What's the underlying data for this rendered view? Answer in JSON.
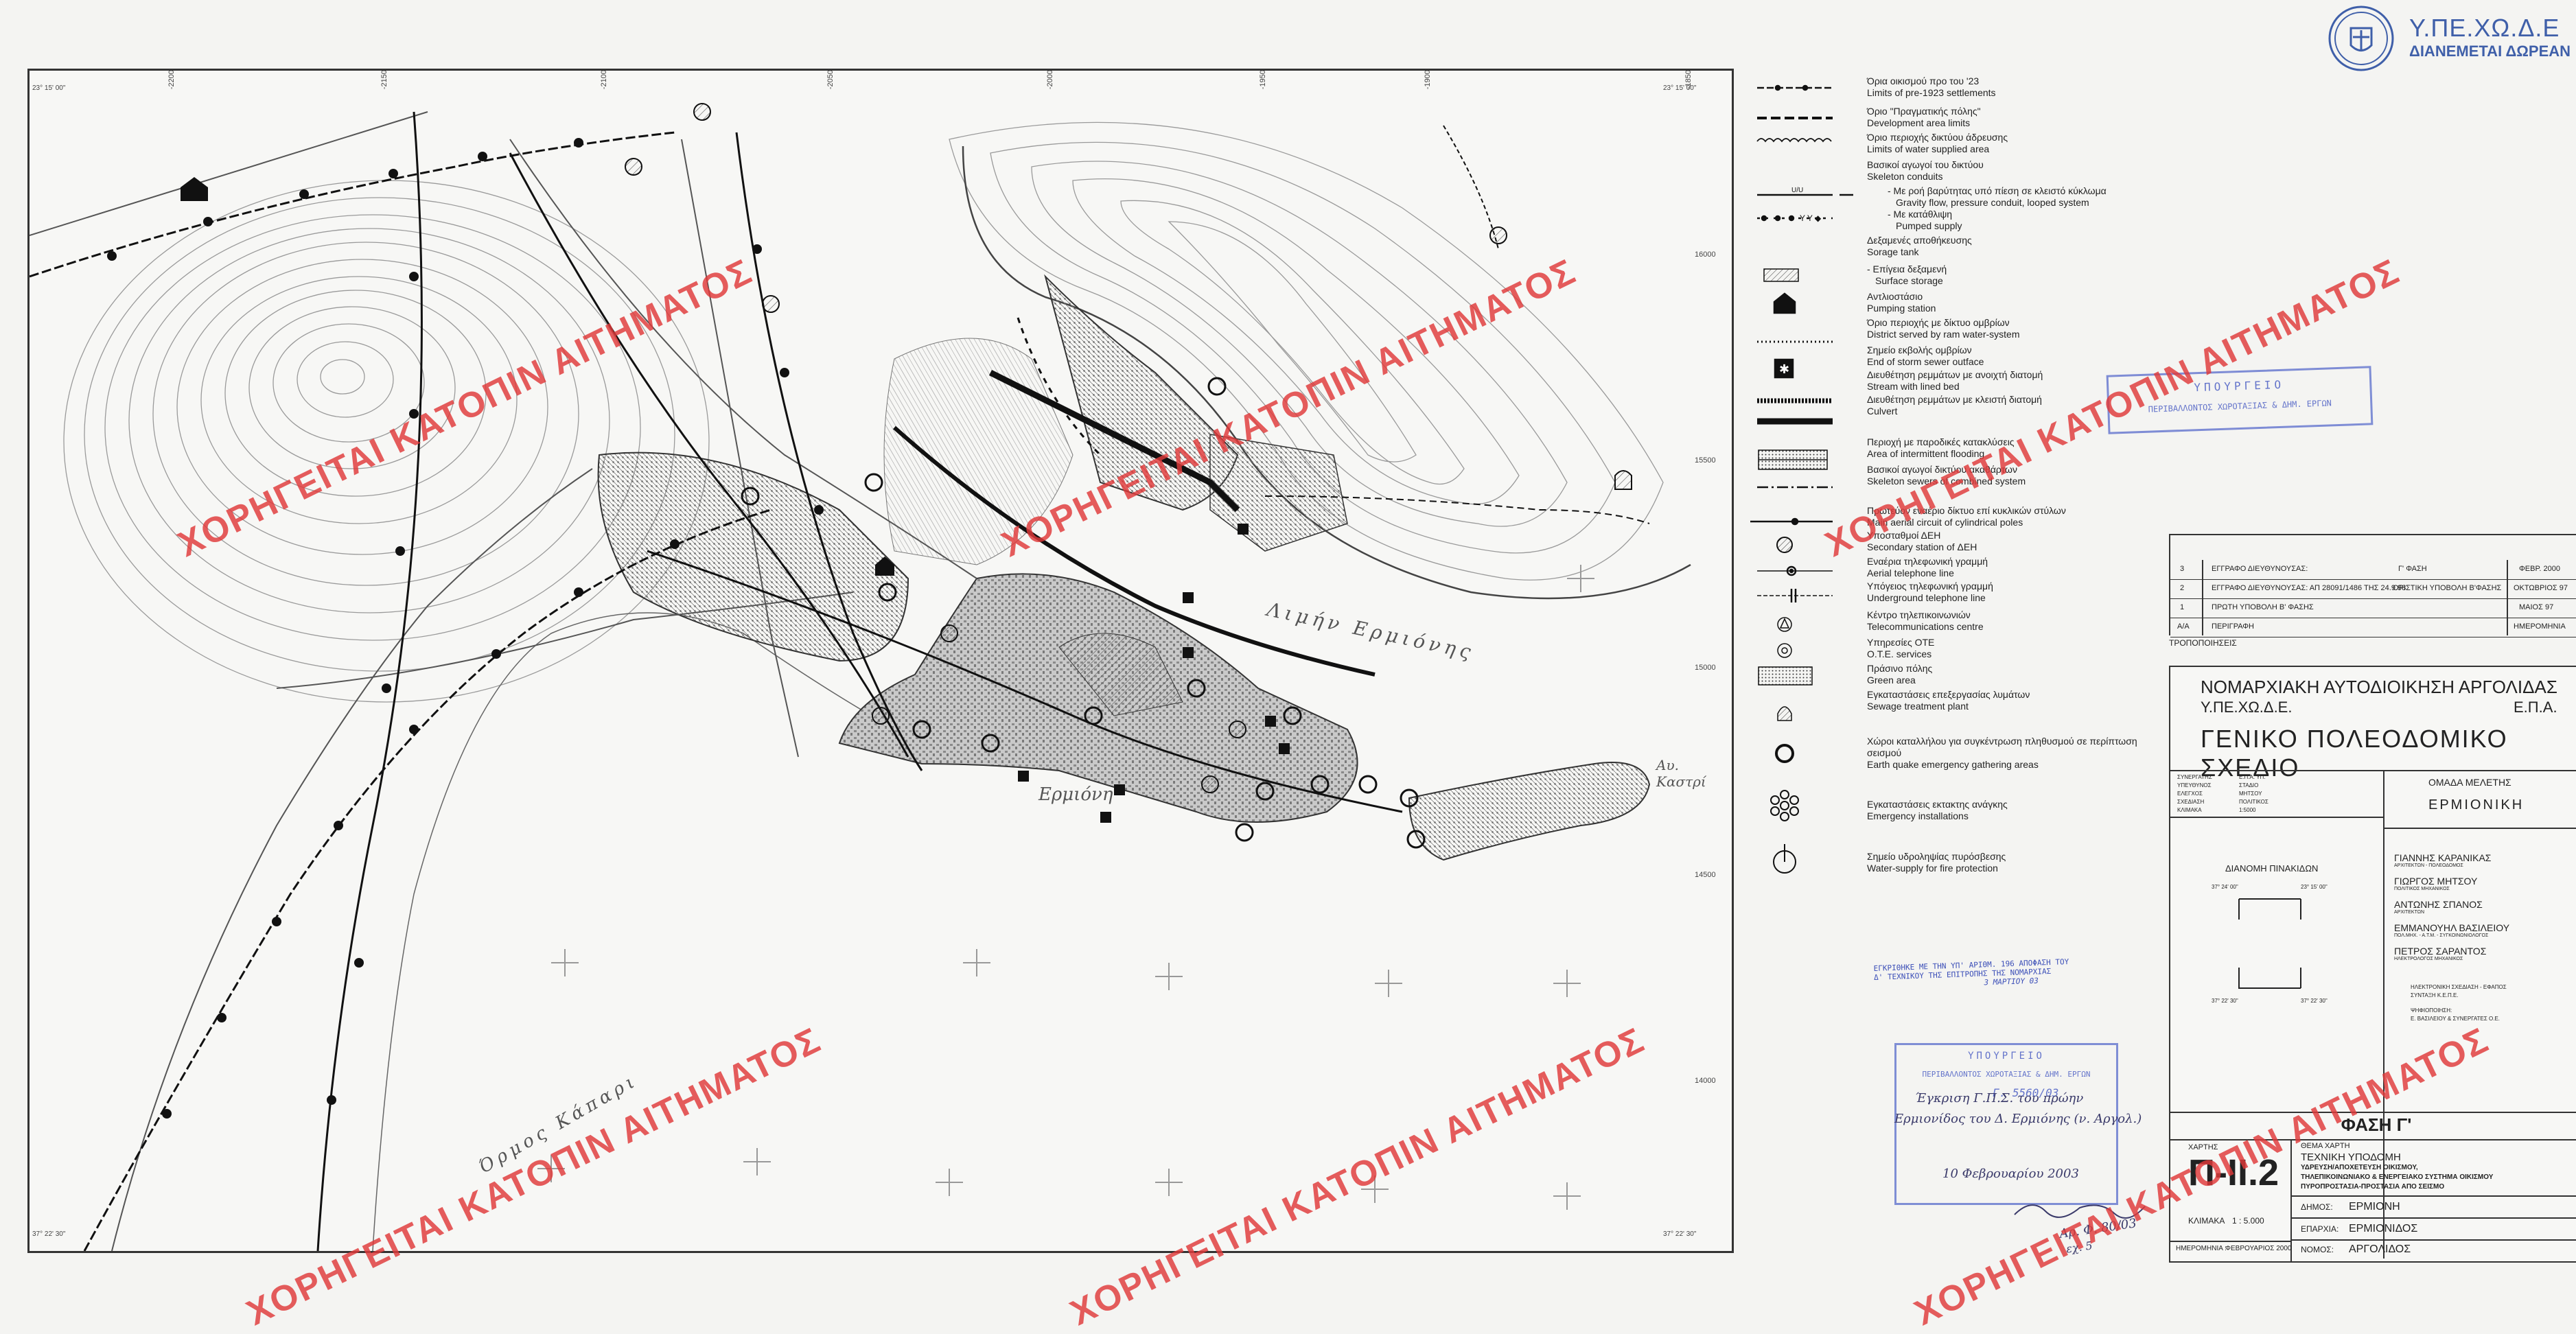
{
  "logo": {
    "title": "Υ.ΠΕ.ΧΩ.Δ.Ε",
    "subtitle": "ΔΙΑΝΕΜΕΤΑΙ ΔΩΡΕΑΝ"
  },
  "watermark_text": "ΧΟΡΗΓΕΙΤΑΙ ΚΑΤΟΠΙΝ ΑΙΤΗΜΑΤΟΣ",
  "map": {
    "top_grid": [
      "-22000",
      "-21500",
      "-21000",
      "-20500",
      "-20000",
      "-19500",
      "-19000",
      "-18500"
    ],
    "right_grid": [
      "16000",
      "15500",
      "15000",
      "14500",
      "14000"
    ],
    "corner_tl": "23° 15' 00\"",
    "corner_tr": "23° 15' 00\"",
    "corner_bl": "37° 22' 30\"",
    "corner_br": "37° 22' 30\"",
    "place_limin": "Λιμήν Ερμιόνης",
    "place_ermioni": "Ερμιόνη",
    "place_kapari": "Όρμος Κάπαρι",
    "place_kastri": "Αυ. Καστρί"
  },
  "legend": [
    {
      "icon": "dashed-cross-line-icon",
      "gr": "Όρια οικισμού προ του '23",
      "en": "Limits of pre-1923 settlements"
    },
    {
      "icon": "dashed-bold-line-icon",
      "gr": "Όριο \"Πραγματικής πόλης\"",
      "en": "Development area limits"
    },
    {
      "icon": "scalloped-line-icon",
      "gr": "Όριο περιοχής δικτύου άδρευσης",
      "en": "Limits of water supplied area"
    },
    {
      "icon": "",
      "gr": "Βασικοί αγωγοί του δικτύου",
      "en": "Skeleton conduits"
    },
    {
      "icon": "gravity-line-icon",
      "gr": "- Με ροή βαρύτητας υπό πίεση σε κλειστό κύκλωμα",
      "en": "Gravity flow, pressure conduit, looped system"
    },
    {
      "icon": "pumped-line-icon",
      "gr": "- Με κατάθλιψη",
      "en": "Pumped supply"
    },
    {
      "icon": "",
      "gr": "Δεξαμενές αποθήκευσης",
      "en": "Sorage tank"
    },
    {
      "icon": "hatched-rect-icon",
      "gr": "- Επίγεια δεξαμενή",
      "en": "Surface storage"
    },
    {
      "icon": "house-arrow-icon",
      "gr": "Αντλιοστάσιο",
      "en": "Pumping station"
    },
    {
      "icon": "dotted-line-icon",
      "gr": "Όριο περιοχής με δίκτυο ομβρίων",
      "en": "District served by ram water-system"
    },
    {
      "icon": "star-square-icon",
      "gr": "Σημείο εκβολής ομβρίων",
      "en": "End of storm sewer outface"
    },
    {
      "icon": "lined-stream-icon",
      "gr": "Διευθέτηση ρεμμάτων με ανοιχτή διατομή",
      "en": "Stream with lined bed"
    },
    {
      "icon": "culvert-icon",
      "gr": "Διευθέτηση ρεμμάτων με κλειστή διατομή",
      "en": "Culvert"
    },
    {
      "icon": "flood-area-icon",
      "gr": "Περιοχή με παροδικές κατακλύσεις",
      "en": "Area of intermittent flooding"
    },
    {
      "icon": "dash-dot-line-icon",
      "gr": "Βασικοί αγωγοί δικτύου ακαθάρτων",
      "en": "Skeleton sewers of combined system"
    },
    {
      "icon": "pole-line-icon",
      "gr": "Πρωτεύον εναέριο δίκτυο επί κυκλικών στύλων",
      "en": "Main aerial circuit of cylindrical poles"
    },
    {
      "icon": "hatched-circle-icon",
      "gr": "Υποσταθμοί ΔΕΗ",
      "en": "Secondary station of ΔΕΗ"
    },
    {
      "icon": "aerial-phone-icon",
      "gr": "Εναέρια τηλεφωνική γραμμή",
      "en": "Aerial telephone line"
    },
    {
      "icon": "underground-phone-icon",
      "gr": "Υπόγειος τηλεφωνική γραμμή",
      "en": "Underground telephone line"
    },
    {
      "icon": "triangle-circle-icon",
      "gr": "Κέντρο τηλεπικοινωνιών",
      "en": "Telecommunications centre"
    },
    {
      "icon": "ote-circle-icon",
      "gr": "Υπηρεσίες ΟΤΕ",
      "en": "O.T.E. services"
    },
    {
      "icon": "green-pattern-icon",
      "gr": "Πράσινο πόλης",
      "en": "Green area"
    },
    {
      "icon": "arch-icon",
      "gr": "Εγκαταστάσεις επεξεργασίας λυμάτων",
      "en": "Sewage treatment plant"
    },
    {
      "icon": "ring-icon",
      "gr": "Χώροι καταλλήλου για συγκέντρωση πληθυσμού σε περίπτωση σεισμού",
      "en": "Earth quake emergency gathering areas"
    },
    {
      "icon": "emergency-flower-icon",
      "gr": "Εγκαταστάσεις εκτακτης ανάγκης",
      "en": "Emergency installations"
    },
    {
      "icon": "hydrant-icon",
      "gr": "Σημείο υδροληψίας πυρόσβεσης",
      "en": "Water-supply for fire protection"
    }
  ],
  "stamp1": {
    "line1": "ΥΠΟΥΡΓΕΙΟ",
    "line2": "ΠΕΡΙΒΑΛΛΟΝΤΟΣ ΧΩΡΟΤΑΞΙΑΣ & ΔΗΜ. ΕΡΓΩΝ"
  },
  "revisions": [
    {
      "no": "3",
      "desc": "ΕΓΓΡΑΦΟ ΔΙΕΥΘΥΝΟΥΣΑΣ:",
      "phase": "Γ' ΦΑΣΗ",
      "date": "ΦΕΒΡ. 2000"
    },
    {
      "no": "2",
      "desc": "ΕΓΓΡΑΦΟ ΔΙΕΥΘΥΝΟΥΣΑΣ: ΑΠ 28091/1486 ΤΗΣ 24.9.98",
      "phase": "ΟΡΙΣΤΙΚΗ ΥΠΟΒΟΛΗ Β'ΦΑΣΗΣ",
      "date": "ΟΚΤΩΒΡΙΟΣ 97"
    },
    {
      "no": "1",
      "desc": "ΠΡΩΤΗ ΥΠΟΒΟΛΗ Β' ΦΑΣΗΣ",
      "phase": "",
      "date": "ΜΑΙΟΣ 97"
    },
    {
      "no": "Α/Α",
      "desc": "ΠΕΡΙΓΡΑΦΗ",
      "phase": "",
      "date": "ΗΜΕΡΟΜΗΝΙΑ"
    }
  ],
  "revisions_caption": "ΤΡΟΠΟΠΟΙΗΣΕΙΣ",
  "title_block": {
    "authority": "ΝΟΜΑΡΧΙΑΚΗ ΑΥΤΟΔΙΟΙΚΗΣΗ ΑΡΓΟΛΙΔΑΣ",
    "ministry": "Υ.ΠΕ.ΧΩ.Δ.Ε.",
    "epa": "Ε.Π.Α.",
    "plan_title": "ΓΕΝΙΚΟ ΠΟΛΕΟΔΟΜΙΚΟ ΣΧΕΔΙΟ",
    "study_group_label": "ΟΜΑΔΑ ΜΕΛΕΤΗΣ",
    "study_name": "ΕΡΜΙΟΝΙΚΗ",
    "sheet_distribution": "ΔΙΑΝΟΜΗ ΠΙΝΑΚΙΔΩΝ",
    "team": [
      {
        "name": "ΓΙΑΝΝΗΣ ΚΑΡΑΝΙΚΑΣ",
        "role": "ΑΡΧΙΤΕΚΤΩΝ - ΠΟΛΕΟΔΟΜΟΣ"
      },
      {
        "name": "ΓΙΩΡΓΟΣ ΜΗΤΣΟΥ",
        "role": "ΠΟΛΙΤΙΚΟΣ ΜΗΧΑΝΙΚΟΣ"
      },
      {
        "name": "ΑΝΤΩΝΗΣ ΣΠΑΝΟΣ",
        "role": "ΑΡΧΙΤΕΚΤΩΝ"
      },
      {
        "name": "ΕΜΜΑΝΟΥΗΛ ΒΑΣΙΛΕΙΟΥ",
        "role": "ΠΟΛ.ΜΗΧ. - Α.Τ.Μ. - ΣΥΓΚΟΙΝΩΝΙΟΛΟΓΟΣ"
      },
      {
        "name": "ΠΕΤΡΟΣ ΣΑΡΑΝΤΟΣ",
        "role": "ΗΛΕΚΤΡΟΛΟΓΟΣ ΜΗΧΑΝΙΚΟΣ"
      }
    ],
    "ecad_label": "ΗΛΕΚΤΡΟΝΙΚΗ ΣΧΕΔΙΑΣΗ - ΕΦΑΠΟΣ",
    "ecad_value": "ΣΥΝΤΑΞΗ Κ.Ε.Π.Ε.",
    "digitizing_label": "ΨΗΦΙΟΠΟΙΗΣΗ:",
    "digitizing_value": "Ε. ΒΑΣΙΛΕΙΟΥ & ΣΥΝΕΡΓΑΤΕΣ Ο.Ε.",
    "phase": "ΦΑΣΗ Γ'",
    "map_label": "ΧΑΡΤΗΣ",
    "map_code": "Π-ΙΙ.2",
    "subject_label": "ΘΕΜΑ ΧΑΡΤΗ",
    "subject1": "ΤΕΧΝΙΚΗ ΥΠΟΔΟΜΗ",
    "subject2": "ΥΔΡΕΥΣΗ/ΑΠΟΧΕΤΕΥΣΗ ΟΙΚΙΣΜΟΥ,",
    "subject3": "ΤΗΛΕΠΙΚΟΙΝΩΝΙΑΚΟ & ΕΝΕΡΓΕΙΑΚΟ ΣΥΣΤΗΜΑ ΟΙΚΙΣΜΟΥ",
    "subject4": "ΠΥΡΟΠΡΟΣΤΑΣΙΑ-ΠΡΟΣΤΑΣΙΑ ΑΠΟ ΣΕΙΣΜΟ",
    "scale_label": "ΚΛΙΜΑΚΑ",
    "scale_value": "1 : 5.000",
    "date_label": "ΗΜΕΡΟΜΗΝΙΑ :",
    "date_value": "ΦΕΒΡΟΥΑΡΙΟΣ 2000",
    "dimos_label": "ΔΗΜΟΣ:",
    "dimos_value": "ΕΡΜΙΟΝΗ",
    "eparchia_label": "ΕΠΑΡΧΙΑ:",
    "eparchia_value": "ΕΡΜΙΟΝΙΔΟΣ",
    "nomos_label": "ΝΟΜΟΣ:",
    "nomos_value": "ΑΡΓΟΛΙΔΟΣ",
    "inset_tl": "37° 24' 00\"",
    "inset_tr": "23° 15' 00\"",
    "inset_bl": "37° 22' 30\"",
    "inset_br": "37° 22' 30\"",
    "info_labels": [
      "ΣΥΝΕΡΓΑΤΗΣ",
      "ΥΠΕΥΘΥΝΟΣ",
      "ΕΛΕΓΧΟΣ",
      "ΣΧΕΔΙΑΣΗ",
      "ΚΛΙΜΑΚΑ"
    ],
    "info_values": [
      "Ε.Π.Α. ΥΠ.",
      "ΣΤΑΔΙΟ",
      "ΜΗΤΣΟΥ",
      "ΠΟΛΙΤΙΚΟΣ",
      "1:5000"
    ]
  },
  "annotations": {
    "blue_note1": "ΕΓΚΡΙΘΗΚΕ ΜΕ ΤΗΝ ΥΠ' ΑΡΙΘΜ. 196 ΑΠΟΦΑΣΗ ΤΟΥ",
    "blue_note2": "Δ' ΤΕΧΝΙΚΟΥ ΤΗΣ ΕΠΙΤΡΟΠΗΣ ΤΗΣ ΝΟΜΑΡΧΙΑΣ",
    "blue_note3": "3 ΜΑΡΤΙΟΥ 03",
    "stamp2_line1": "ΥΠΟΥΡΓΕΙΟ",
    "stamp2_line2": "ΠΕΡΙΒΑΛΛΟΝΤΟΣ ΧΩΡΟΤΑΞΙΑΣ & ΔΗΜ. ΕΡΓΩΝ",
    "stamp2_line3": "Γ. 5560/03",
    "hand1": "Έγκριση Γ.Π.Σ. του πρώην",
    "hand2": "Ερμιονίδος του Δ. Ερμιόνης (ν. Αργολ.)",
    "hand3": "10 Φεβρουαρίου 2003",
    "hand4": "Αρ. Φ. 80/03",
    "hand5": "εχ. 5"
  }
}
